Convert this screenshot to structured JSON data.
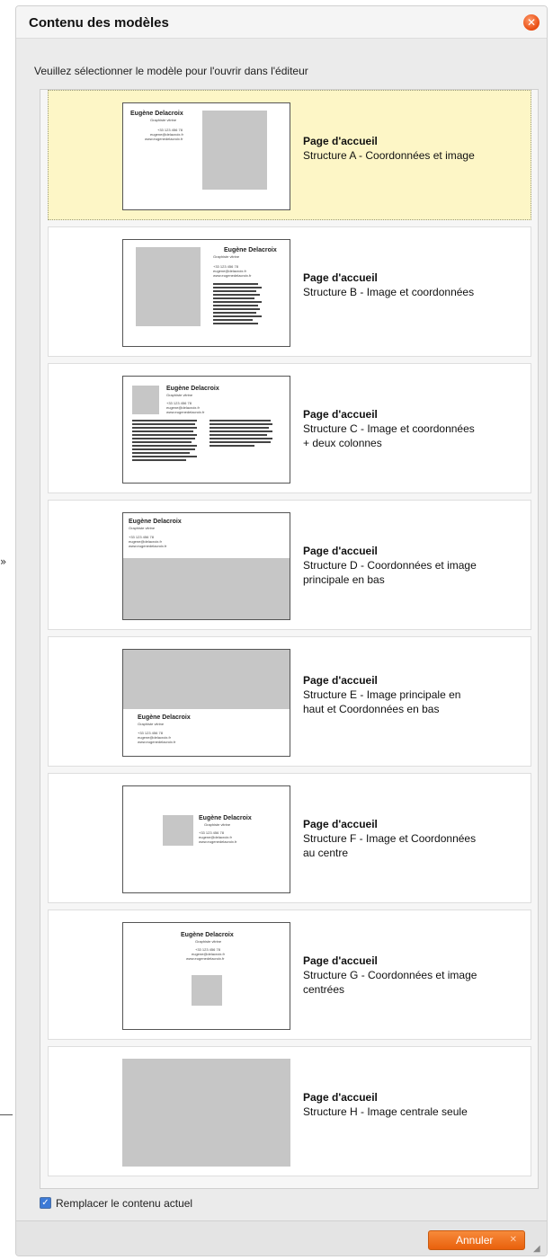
{
  "dialog": {
    "title": "Contenu des modèles",
    "close_icon": "close-icon",
    "instruction": "Veuillez sélectionner le modèle pour l'ouvrir dans l'éditeur"
  },
  "preview": {
    "name": "Eugène Delacroix",
    "subtitle": "Graphiste vitrine",
    "phone": "+33 123 456 78",
    "email": "eugene@delacroix.fr",
    "web": "www.eugenedelacroix.fr"
  },
  "templates": [
    {
      "title": "Page d'accueil",
      "description": "Structure A - Coordonnées et image",
      "selected": true
    },
    {
      "title": "Page d'accueil",
      "description": "Structure B - Image et coordonnées",
      "selected": false
    },
    {
      "title": "Page d'accueil",
      "description": "Structure C - Image et coordonnées + deux colonnes",
      "selected": false
    },
    {
      "title": "Page d'accueil",
      "description": "Structure D - Coordonnées et image principale en bas",
      "selected": false
    },
    {
      "title": "Page d'accueil",
      "description": "Structure E - Image principale en haut et Coordonnées en bas",
      "selected": false
    },
    {
      "title": "Page d'accueil",
      "description": "Structure F - Image et Coordonnées au centre",
      "selected": false
    },
    {
      "title": "Page d'accueil",
      "description": "Structure G - Coordonnées et image centrées",
      "selected": false
    },
    {
      "title": "Page d'accueil",
      "description": "Structure H - Image centrale seule",
      "selected": false
    }
  ],
  "replace_content": {
    "label": "Remplacer le contenu actuel",
    "checked": true
  },
  "footer": {
    "cancel_label": "Annuler",
    "cancel_icon": "close-icon"
  },
  "colors": {
    "accent": "#e9600c",
    "selected_bg": "#fdf6c6",
    "placeholder": "#c6c6c6"
  }
}
